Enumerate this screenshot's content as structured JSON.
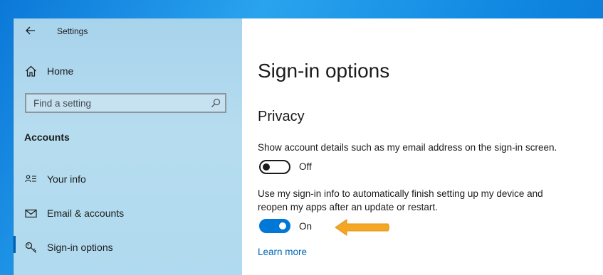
{
  "window": {
    "title": "Settings"
  },
  "sidebar": {
    "home_label": "Home",
    "search_placeholder": "Find a setting",
    "section_heading": "Accounts",
    "items": [
      {
        "label": "Your info",
        "icon": "person-card-icon"
      },
      {
        "label": "Email & accounts",
        "icon": "envelope-icon"
      },
      {
        "label": "Sign-in options",
        "icon": "key-icon",
        "selected": true
      }
    ]
  },
  "main": {
    "page_title": "Sign-in options",
    "section_title": "Privacy",
    "settings": [
      {
        "description": "Show account details such as my email address on the sign-in screen.",
        "state_label": "Off",
        "enabled": false
      },
      {
        "description": "Use my sign-in info to automatically finish setting up my device and reopen my apps after an update or restart.",
        "state_label": "On",
        "enabled": true
      }
    ],
    "learn_more_label": "Learn more"
  },
  "colors": {
    "accent": "#0078d7",
    "link": "#0066b4",
    "sidebar_bg": "#b0daef",
    "callout_arrow": "#f5a623"
  }
}
